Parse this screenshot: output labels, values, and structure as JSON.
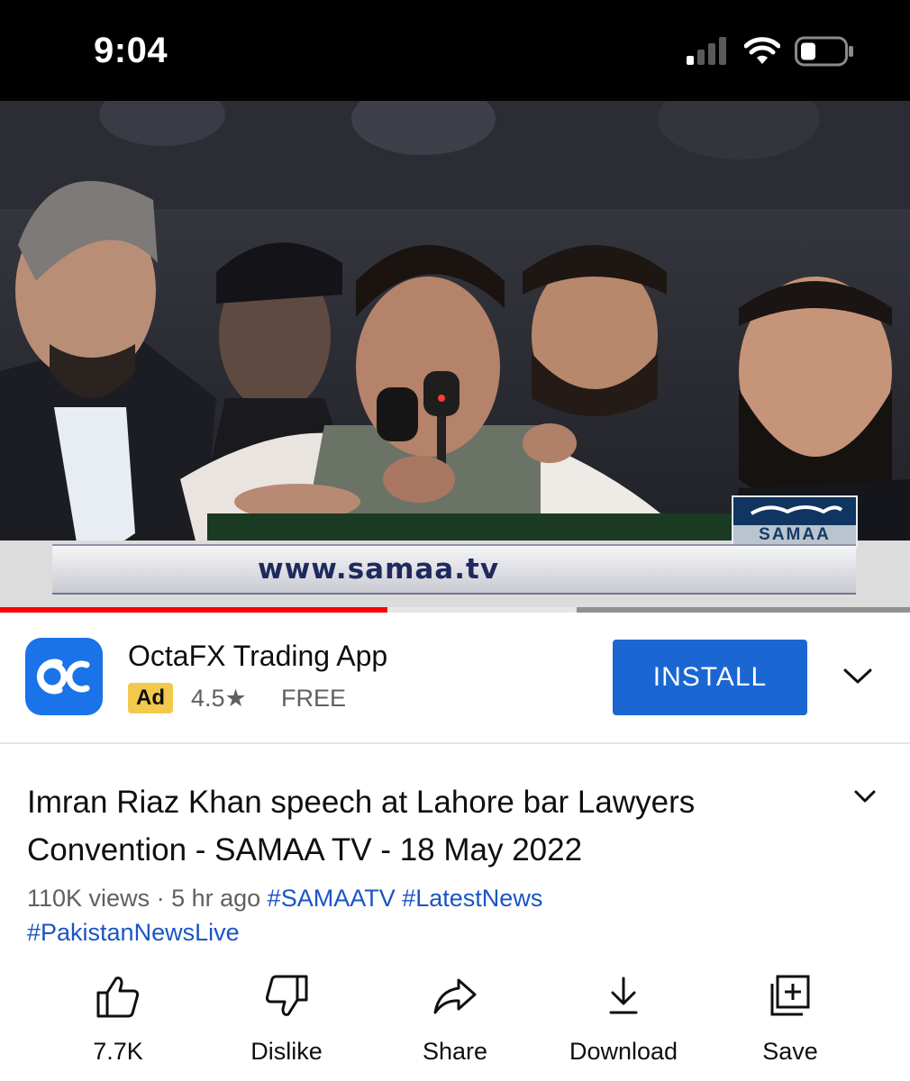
{
  "status_bar": {
    "time": "9:04"
  },
  "video": {
    "ticker_text": "www.samaa.tv",
    "channel_logo_text": "SAMAA",
    "progress_fraction": 0.426,
    "buffer_start_fraction": 0.634
  },
  "ad": {
    "app_name": "OctaFX Trading App",
    "badge": "Ad",
    "rating": "4.5★",
    "price": "FREE",
    "install_label": "INSTALL",
    "icon_color": "#1a73e8",
    "button_color": "#1a66d2"
  },
  "video_info": {
    "title": "Imran Riaz Khan speech at Lahore bar Lawyers Convention - SAMAA TV - 18 May 2022",
    "views": "110K views",
    "separator": " · ",
    "age": "5 hr ago",
    "hashtags": [
      "#SAMAATV",
      "#LatestNews",
      "#PakistanNewsLive"
    ],
    "hashtag_color": "#1a55c4"
  },
  "actions": [
    {
      "label": "7.7K",
      "icon": "like-icon"
    },
    {
      "label": "Dislike",
      "icon": "dislike-icon"
    },
    {
      "label": "Share",
      "icon": "share-icon"
    },
    {
      "label": "Download",
      "icon": "download-icon"
    },
    {
      "label": "Save",
      "icon": "save-playlist-icon"
    }
  ]
}
